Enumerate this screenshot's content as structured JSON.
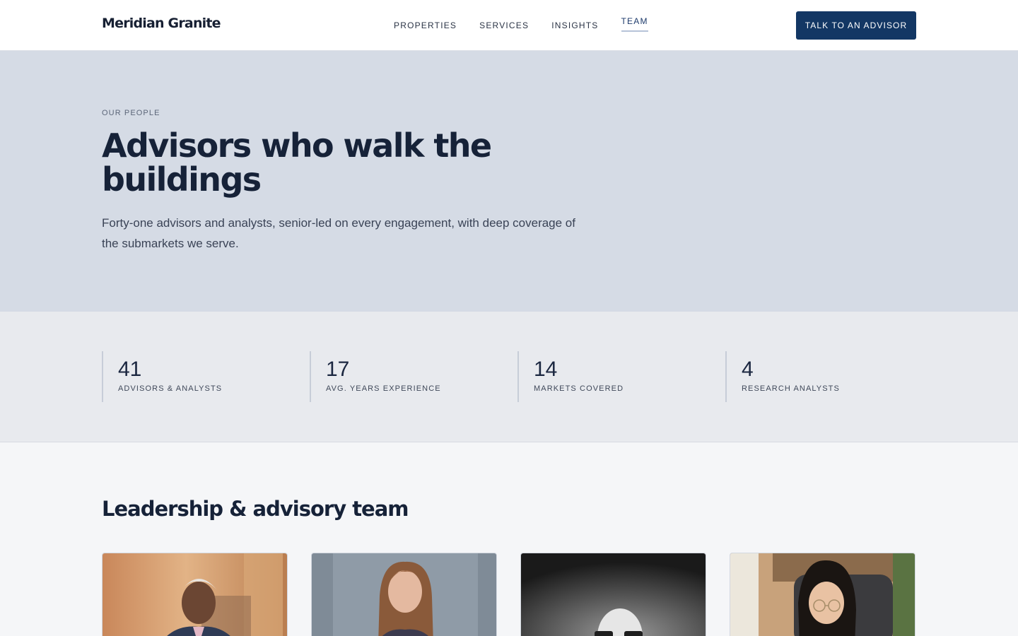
{
  "header": {
    "logo": "Meridian Granite",
    "nav": [
      {
        "label": "PROPERTIES",
        "active": false
      },
      {
        "label": "SERVICES",
        "active": false
      },
      {
        "label": "INSIGHTS",
        "active": false
      },
      {
        "label": "TEAM",
        "active": true
      }
    ],
    "cta_label": "TALK TO AN ADVISOR"
  },
  "hero": {
    "eyebrow": "OUR PEOPLE",
    "title": "Advisors who walk the buildings",
    "subtitle": "Forty-one advisors and analysts, senior-led on every engagement, with deep coverage of the submarkets we serve."
  },
  "stats": [
    {
      "value": "41",
      "label": "ADVISORS & ANALYSTS"
    },
    {
      "value": "17",
      "label": "AVG. YEARS EXPERIENCE"
    },
    {
      "value": "14",
      "label": "MARKETS COVERED"
    },
    {
      "value": "4",
      "label": "RESEARCH ANALYSTS"
    }
  ],
  "team": {
    "title": "Leadership & advisory team"
  },
  "colors": {
    "brand_navy": "#133764",
    "hero_bg": "#d5dbe5",
    "stats_bg": "#e8eaee",
    "page_bg": "#f5f6f8"
  }
}
